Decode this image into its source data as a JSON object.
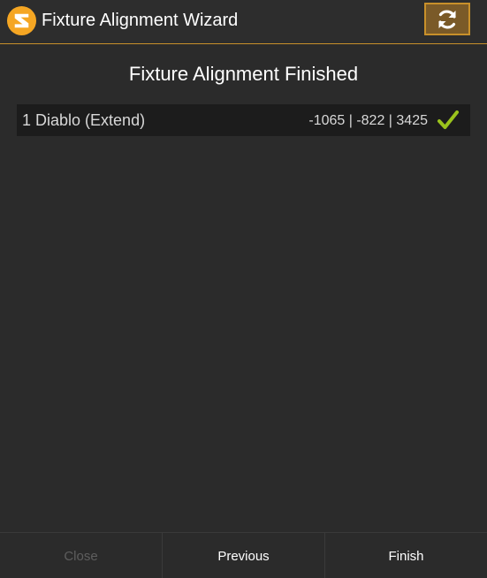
{
  "window": {
    "title": "Fixture Alignment Wizard",
    "logo_icon": "app-logo-icon",
    "refresh_icon": "refresh-icon"
  },
  "heading": "Fixture Alignment Finished",
  "fixtures": [
    {
      "name": "1 Diablo (Extend)",
      "coordinates": "-1065 | -822 | 3425",
      "status_icon": "check-icon",
      "status": "aligned"
    }
  ],
  "buttons": {
    "close": "Close",
    "previous": "Previous",
    "finish": "Finish"
  },
  "colors": {
    "accent": "#c8902a",
    "logo": "#f5a623",
    "check": "#9ac31c",
    "background": "#2b2b2b",
    "row_background": "#1c1c1c",
    "disabled_text": "#5e5e5e"
  }
}
